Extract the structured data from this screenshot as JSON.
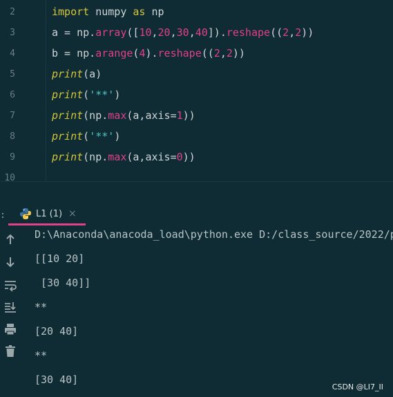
{
  "editor": {
    "line_numbers": [
      "2",
      "3",
      "4",
      "5",
      "6",
      "7",
      "8",
      "9",
      "10"
    ],
    "lines": [
      [
        {
          "t": "import",
          "c": "kw"
        },
        {
          "t": " numpy ",
          "c": ""
        },
        {
          "t": "as",
          "c": "kw"
        },
        {
          "t": " np",
          "c": ""
        }
      ],
      [
        {
          "t": "a = np.",
          "c": ""
        },
        {
          "t": "array",
          "c": "fn"
        },
        {
          "t": "([",
          "c": ""
        },
        {
          "t": "10",
          "c": "num"
        },
        {
          "t": ",",
          "c": ""
        },
        {
          "t": "20",
          "c": "num"
        },
        {
          "t": ",",
          "c": ""
        },
        {
          "t": "30",
          "c": "num"
        },
        {
          "t": ",",
          "c": ""
        },
        {
          "t": "40",
          "c": "num"
        },
        {
          "t": "]).",
          "c": ""
        },
        {
          "t": "reshape",
          "c": "fn"
        },
        {
          "t": "((",
          "c": ""
        },
        {
          "t": "2",
          "c": "num"
        },
        {
          "t": ",",
          "c": ""
        },
        {
          "t": "2",
          "c": "num"
        },
        {
          "t": "))",
          "c": ""
        }
      ],
      [
        {
          "t": "b = np.",
          "c": ""
        },
        {
          "t": "arange",
          "c": "fn"
        },
        {
          "t": "(",
          "c": ""
        },
        {
          "t": "4",
          "c": "num"
        },
        {
          "t": ").",
          "c": ""
        },
        {
          "t": "reshape",
          "c": "fn"
        },
        {
          "t": "((",
          "c": ""
        },
        {
          "t": "2",
          "c": "num"
        },
        {
          "t": ",",
          "c": ""
        },
        {
          "t": "2",
          "c": "num"
        },
        {
          "t": "))",
          "c": ""
        }
      ],
      [
        {
          "t": "print",
          "c": "italic-kw"
        },
        {
          "t": "(a)",
          "c": ""
        }
      ],
      [
        {
          "t": "print",
          "c": "italic-kw"
        },
        {
          "t": "(",
          "c": ""
        },
        {
          "t": "'**'",
          "c": "str"
        },
        {
          "t": ")",
          "c": ""
        }
      ],
      [
        {
          "t": "print",
          "c": "italic-kw"
        },
        {
          "t": "(np.",
          "c": ""
        },
        {
          "t": "max",
          "c": "fn"
        },
        {
          "t": "(a,axis=",
          "c": ""
        },
        {
          "t": "1",
          "c": "num"
        },
        {
          "t": "))",
          "c": ""
        }
      ],
      [
        {
          "t": "print",
          "c": "italic-kw"
        },
        {
          "t": "(",
          "c": ""
        },
        {
          "t": "'**'",
          "c": "str"
        },
        {
          "t": ")",
          "c": ""
        }
      ],
      [
        {
          "t": "print",
          "c": "italic-kw"
        },
        {
          "t": "(np.",
          "c": ""
        },
        {
          "t": "max",
          "c": "fn"
        },
        {
          "t": "(a,axis=",
          "c": ""
        },
        {
          "t": "0",
          "c": "num"
        },
        {
          "t": "))",
          "c": ""
        }
      ],
      []
    ]
  },
  "run_panel": {
    "colon": ":",
    "tab_label": "L1 (1)",
    "tab_close": "×",
    "accent_color": "#e0418a"
  },
  "toolbar_icons": [
    "arrow-up-icon",
    "arrow-down-icon",
    "soft-wrap-icon",
    "scroll-to-end-icon",
    "print-icon",
    "trash-icon"
  ],
  "console": {
    "lines": [
      "D:\\Anaconda\\anacoda_load\\python.exe D:/class_source/2022/p",
      "[[10 20]",
      " [30 40]]",
      "**",
      "[20 40]",
      "**",
      "[30 40]"
    ]
  },
  "watermark": "CSDN @LI7_II"
}
